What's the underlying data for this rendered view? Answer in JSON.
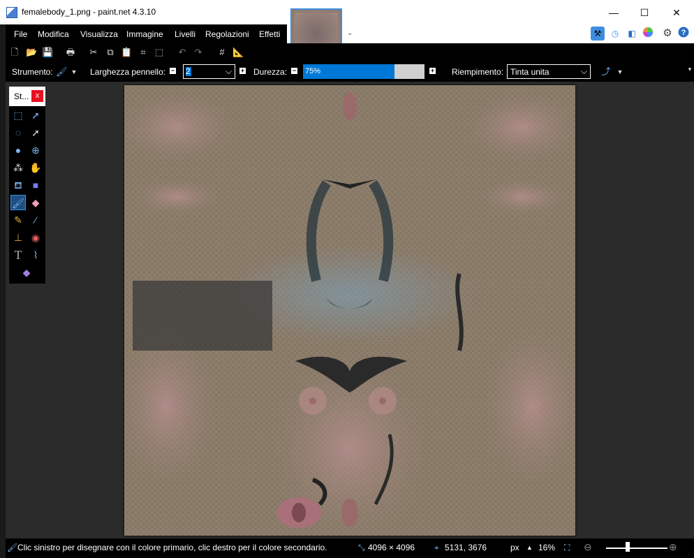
{
  "window": {
    "title": "femalebody_1.png - paint.net 4.3.10",
    "minimize": "—",
    "maximize": "☐",
    "close": "✕"
  },
  "menu": [
    "File",
    "Modifica",
    "Visualizza",
    "Immagine",
    "Livelli",
    "Regolazioni",
    "Effetti"
  ],
  "toolbar": {
    "tool_label": "Strumento:",
    "brush_width_label": "Larghezza pennello:",
    "brush_width_value": "2",
    "hardness_label": "Durezza:",
    "hardness_value": "75%",
    "hardness_percent": 75,
    "fill_label": "Riempimento:",
    "fill_value": "Tinta unita"
  },
  "tools_window": {
    "title": "St...",
    "close": "x"
  },
  "status": {
    "hint": "Clic sinistro per disegnare con il colore primario, clic destro per il colore secondario.",
    "image_size": "4096 × 4096",
    "cursor_pos": "5131, 3676",
    "units": "px",
    "zoom": "16%",
    "zoom_slider_fraction": 0.35
  },
  "colors": {
    "accent": "#0078d7",
    "close_red": "#e81123",
    "selection_blue": "#3d8ee0"
  },
  "icons": {
    "new": "new-document-icon",
    "open": "open-icon",
    "save": "save-icon",
    "print": "print-icon",
    "cut": "cut-icon",
    "copy": "copy-icon",
    "paste": "paste-icon",
    "crop": "crop-icon",
    "deselect": "deselect-icon",
    "undo": "undo-icon",
    "redo": "redo-icon",
    "grid": "grid-icon",
    "ruler": "ruler-icon"
  }
}
